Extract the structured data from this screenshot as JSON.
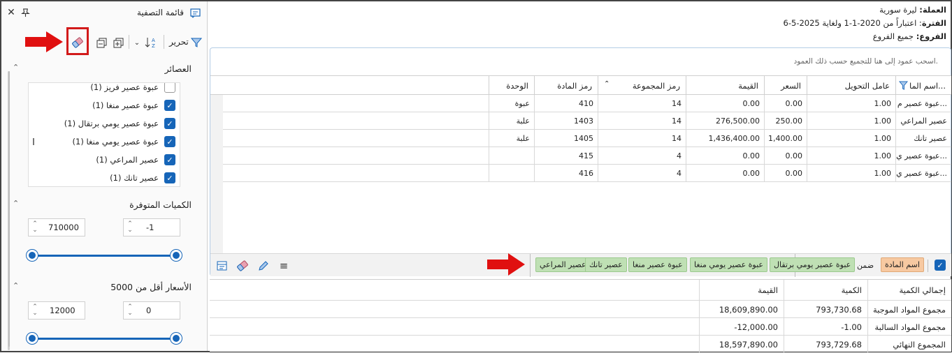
{
  "filter_panel": {
    "title": "قائمة التصفية",
    "toolbar": {
      "edit_label": "تحرير"
    },
    "sections": {
      "items": {
        "title": "العصائر",
        "options": [
          {
            "label": "عبوة عصير فريز (1)",
            "checked": false
          },
          {
            "label": "عبوة عصير منغا (1)",
            "checked": true
          },
          {
            "label": "عبوة عصير يومي برتقال (1)",
            "checked": true
          },
          {
            "label": "عبوة عصير يومي منغا (1)",
            "checked": true
          },
          {
            "label": "عصير المراعي (1)",
            "checked": true
          },
          {
            "label": "عصير تانك (1)",
            "checked": true
          }
        ]
      },
      "quantities": {
        "title": "الكميات المتوفرة",
        "min": "-1",
        "max": "710000"
      },
      "prices": {
        "title": "الأسعار أقل من 5000",
        "min": "0",
        "max": "12000"
      }
    }
  },
  "report_header": {
    "currency_label": "العملة:",
    "currency_value": "ليرة سورية",
    "period_label": "الفترة",
    "period_value": ": اعتباراً من 2020-1-1 ولغاية 2025-5-6",
    "branches_label": "الفروع:",
    "branches_value": "جميع الفروع"
  },
  "grid": {
    "group_hint": "اسحب عمود إلى هنا للتجميع حسب ذلك العمود.",
    "columns": [
      "اسم الما...",
      "عامل التحويل",
      "السعر",
      "القيمة",
      "رمز المجموعة",
      "رمز المادة",
      "الوحدة"
    ],
    "rows": [
      [
        "عبوة عصير م...",
        "1.00",
        "0.00",
        "0.00",
        "14",
        "410",
        "عبوة"
      ],
      [
        "عصير المراعي",
        "1.00",
        "250.00",
        "276,500.00",
        "14",
        "1403",
        "علبة"
      ],
      [
        "عصير تانك",
        "1.00",
        "1,400.00",
        "1,436,400.00",
        "14",
        "1405",
        "علبة"
      ],
      [
        "عبوة عصير ي...",
        "1.00",
        "0.00",
        "0.00",
        "4",
        "415",
        ""
      ],
      [
        "عبوة عصير ي...",
        "1.00",
        "0.00",
        "0.00",
        "4",
        "416",
        ""
      ]
    ],
    "filter_bar": {
      "field": "اسم المادة",
      "operator": "ضمن",
      "values": [
        "عبوة عصير يومي برتقال",
        "عبوة عصير يومي منغا",
        "عبوة عصير منغا",
        "عصير تانك",
        "عصير المراعي"
      ]
    }
  },
  "totals": {
    "columns": [
      "إجمالي الكمية",
      "الكمية",
      "القيمة"
    ],
    "rows": [
      [
        "مجموع المواد الموجبة",
        "793,730.68",
        "18,609,890.00"
      ],
      [
        "مجموع المواد السالبة",
        "-1.00",
        "-12,000.00"
      ],
      [
        "المجموع النهائي",
        "793,729.68",
        "18,597,890.00"
      ]
    ]
  },
  "colors": {
    "accent": "#1665b8",
    "highlight": "#d21a1a",
    "tag_green": "#bfe0b4",
    "tag_orange": "#f7c9a1"
  }
}
